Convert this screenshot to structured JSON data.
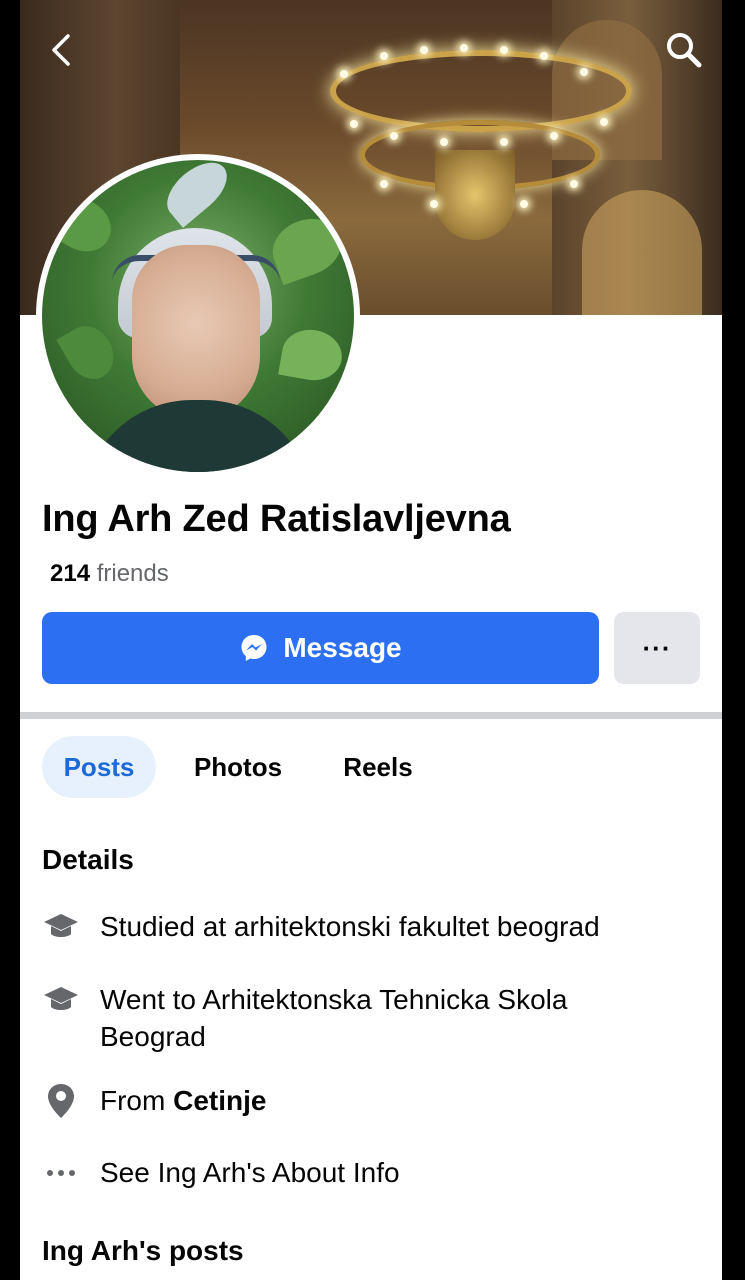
{
  "header": {
    "back_icon": "chevron-left-icon",
    "search_icon": "search-icon"
  },
  "profile": {
    "name": "Ing Arh Zed Ratislavljevna",
    "friends_count": "214",
    "friends_label": "friends"
  },
  "actions": {
    "message_label": "Message",
    "message_icon": "messenger-icon",
    "more_label": "···"
  },
  "tabs": [
    {
      "label": "Posts",
      "active": true
    },
    {
      "label": "Photos",
      "active": false
    },
    {
      "label": "Reels",
      "active": false
    }
  ],
  "details": {
    "title": "Details",
    "items": [
      {
        "icon": "graduation-cap-icon",
        "text": "Studied at arhitektonski fakultet beograd"
      },
      {
        "icon": "graduation-cap-icon",
        "text": "Went to Arhitektonska Tehnicka Skola Beograd"
      },
      {
        "icon": "location-pin-icon",
        "prefix": "From ",
        "bold": "Cetinje"
      },
      {
        "icon": "more-dots-icon",
        "text": "See Ing Arh's About Info"
      }
    ]
  },
  "posts": {
    "title": "Ing Arh's posts"
  },
  "colors": {
    "accent": "#2d6ff3",
    "tab_active_bg": "#e7f1fd",
    "tab_active_text": "#1b6ad8",
    "secondary_button": "#e4e6eb",
    "muted_text": "#65676b"
  }
}
